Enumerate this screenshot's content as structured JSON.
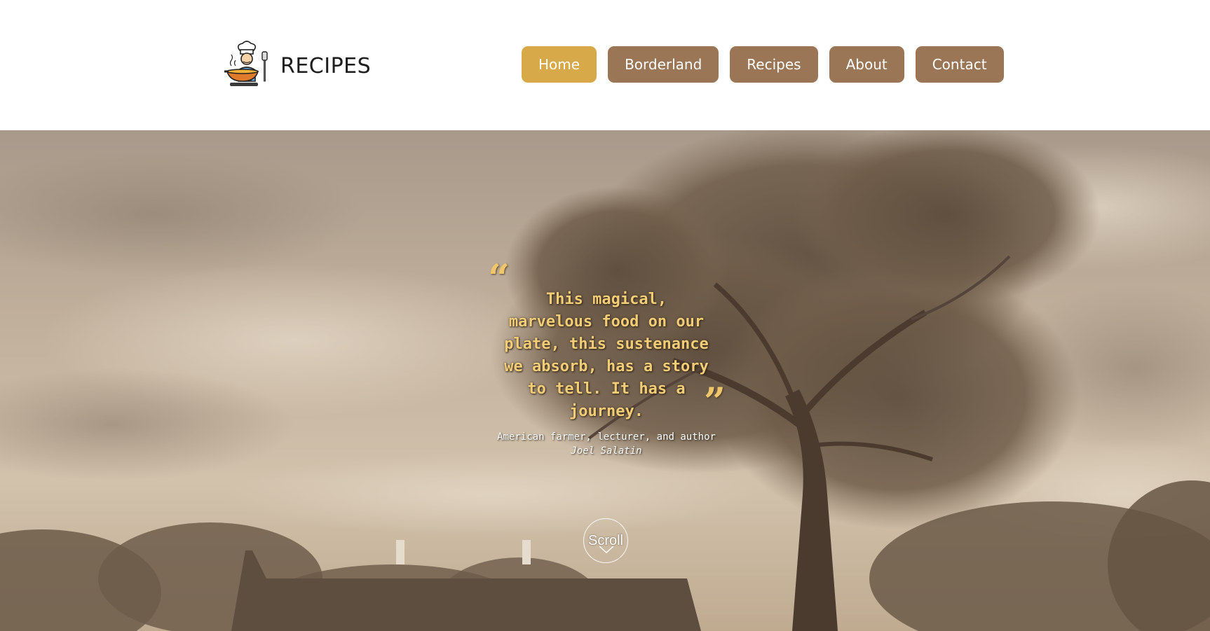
{
  "header": {
    "logo_text": "RECIPES",
    "logo_icon": "chef-cooking-icon",
    "nav": [
      {
        "label": "Home",
        "active": true
      },
      {
        "label": "Borderland",
        "active": false
      },
      {
        "label": "Recipes",
        "active": false
      },
      {
        "label": "About",
        "active": false
      },
      {
        "label": "Contact",
        "active": false
      }
    ]
  },
  "hero": {
    "quote_text": "This magical, marvelous food on our plate, this sustenance we absorb, has a story to tell. It has a journey.",
    "quote_role": "American farmer, lecturer, and author",
    "quote_author": "Joel Salatin",
    "open_quote_mark": "“",
    "close_quote_mark": "”",
    "scroll_label": "Scroll"
  },
  "colors": {
    "nav_active": "#d8a948",
    "nav_default": "#9a7656",
    "quote_text": "#f2cd78",
    "hero_sepia": "#c4b29a"
  }
}
